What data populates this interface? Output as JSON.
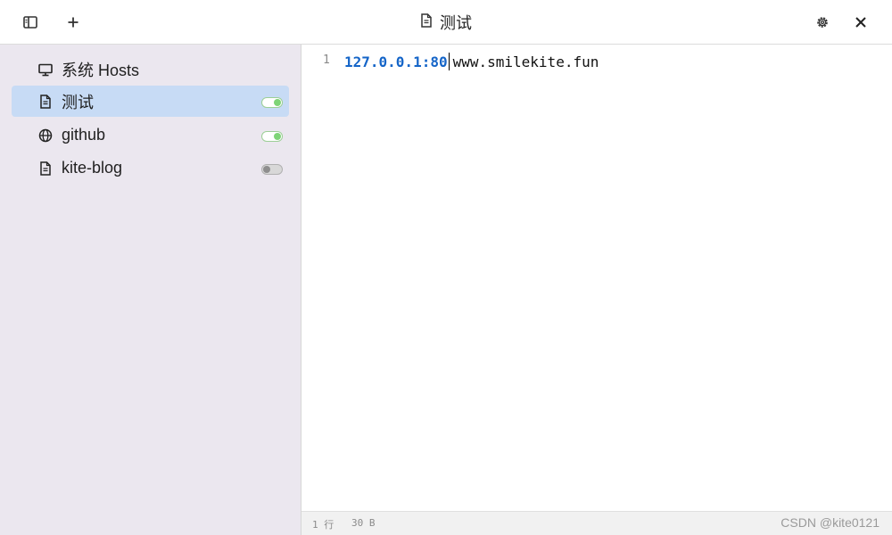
{
  "header": {
    "title": "测试",
    "title_icon": "document-icon",
    "left_buttons": [
      "sidebar-toggle-icon",
      "plus-icon"
    ],
    "right_buttons": [
      "gear-icon",
      "close-icon"
    ]
  },
  "sidebar": {
    "items": [
      {
        "label": "系统 Hosts",
        "icon": "monitor-icon",
        "toggle": null,
        "active": false
      },
      {
        "label": "测试",
        "icon": "document-icon",
        "toggle": "on",
        "active": true
      },
      {
        "label": "github",
        "icon": "globe-icon",
        "toggle": "on",
        "active": false
      },
      {
        "label": "kite-blog",
        "icon": "document-icon",
        "toggle": "off",
        "active": false
      }
    ]
  },
  "editor": {
    "line_number": "1",
    "ip": "127.0.0.1:80",
    "host": "www.smilekite.fun"
  },
  "status": {
    "lines": "1 行",
    "size": "30 B",
    "watermark": "CSDN @kite0121"
  },
  "colors": {
    "accent": "#1565c8",
    "sidebar_bg": "#ebe7ef",
    "active_item_bg": "#c7dbf5",
    "toggle_on": "#7ed477",
    "toggle_off": "#8e8e8e"
  }
}
